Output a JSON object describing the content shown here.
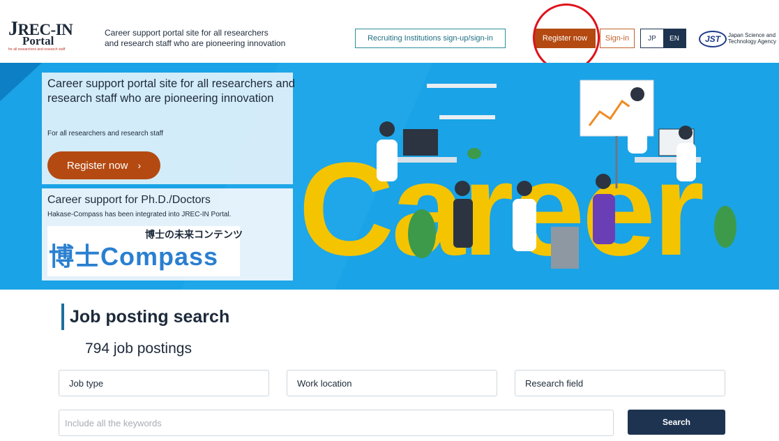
{
  "header": {
    "logo": {
      "main": "REC-IN",
      "j": "J",
      "portal": "Portal",
      "sub": "for all researchers and research staff"
    },
    "tagline_line1": "Career support portal site for all researchers",
    "tagline_line2": "and research staff who are pioneering innovation",
    "recruit_button": "Recruiting Institutions sign-up/sign-in",
    "register_button": "Register now",
    "signin_button": "Sign-in",
    "lang_jp": "JP",
    "lang_en": "EN",
    "jst": {
      "mark": "JST",
      "line1": "Japan Science and",
      "line2": "Technology Agency"
    }
  },
  "hero": {
    "card1_title": "Career support portal site for all researchers and research staff who are pioneering innovation",
    "card1_sub": "For all researchers and research staff",
    "register_label": "Register now",
    "register_chevron": "›",
    "card2_title": "Career support for Ph.D./Doctors",
    "card2_sub": "Hakase-Compass has been integrated into JREC-IN Portal.",
    "hakase_ruby": "博士の未来コンテンツ",
    "hakase_main": "博士Compass",
    "career_word": "Career"
  },
  "search": {
    "title": "Job posting search",
    "count": "794 job postings",
    "job_type": "Job type",
    "work_location": "Work location",
    "research_field": "Research field",
    "keyword_placeholder": "Include all the keywords",
    "search_button": "Search"
  },
  "colors": {
    "brand_orange": "#b44a12",
    "navy": "#1d3350",
    "hero_blue": "#1aa3e6",
    "career_yellow": "#f5c400",
    "highlight_red": "#e0121b"
  }
}
